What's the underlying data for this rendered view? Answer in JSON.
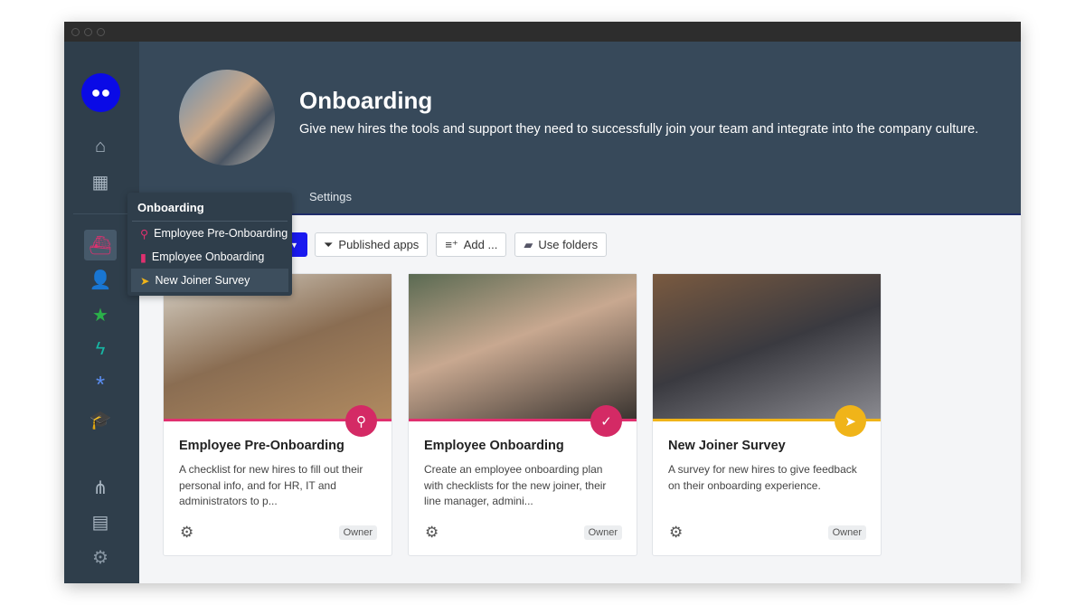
{
  "header": {
    "title": "Onboarding",
    "description": "Give new hires the tools and support they need to successfully join your team and integrate into the company culture.",
    "tabs": [
      {
        "label": "Settings"
      }
    ]
  },
  "sidebar": {
    "icons": [
      "logo",
      "home-icon",
      "grid-icon",
      "ship-icon",
      "user-edit-icon",
      "star-icon",
      "bolt-icon",
      "asterisk-icon",
      "graduation-cap-icon",
      "sitemap-icon",
      "list-icon",
      "gear-icon"
    ],
    "colors": {
      "ship": "#e0306f",
      "user": "#e8a317",
      "star": "#2bb14a",
      "bolt": "#17b6a4",
      "asterisk": "#5b8def",
      "cap": "#c57bd1"
    }
  },
  "popup": {
    "title": "Onboarding",
    "items": [
      {
        "label": "Employee Pre-Onboarding"
      },
      {
        "label": "Employee Onboarding"
      },
      {
        "label": "New Joiner Survey"
      }
    ]
  },
  "toolbar": {
    "published": "Published apps",
    "add": "Add ...",
    "folders": "Use folders"
  },
  "cards": [
    {
      "title": "Employee Pre-Onboarding",
      "description": "A checklist for new hires to fill out their personal info, and for HR, IT and administrators to p...",
      "role": "Owner",
      "color": "#e0306f"
    },
    {
      "title": "Employee Onboarding",
      "description": "Create an employee onboarding plan with checklists for the new joiner, their line manager, admini...",
      "role": "Owner",
      "color": "#e0306f"
    },
    {
      "title": "New Joiner Survey",
      "description": "A survey for new hires to give feedback on their onboarding experience.",
      "role": "Owner",
      "color": "#f0b419"
    }
  ]
}
